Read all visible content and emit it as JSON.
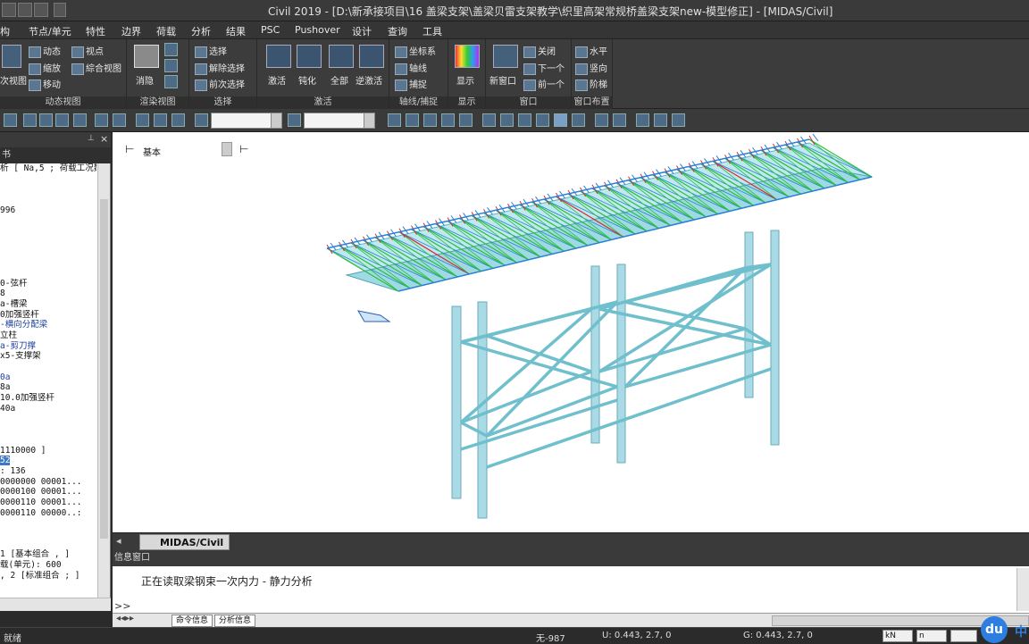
{
  "window": {
    "title": "Civil 2019 - [D:\\新承接项目\\16 盖梁支架\\盖梁贝雷支架教学\\织里高架常规桥盖梁支架new-模型修正] - [MIDAS/Civil]"
  },
  "menubar": [
    "构",
    "节点/单元",
    "特性",
    "边界",
    "荷载",
    "分析",
    "结果",
    "PSC",
    "Pushover",
    "设计",
    "查询",
    "工具"
  ],
  "ribbon": {
    "groups": [
      "动态视图",
      "渲染视图",
      "选择",
      "激活",
      "轴线/捕捉",
      "显示",
      "窗口",
      "窗口布置"
    ],
    "dynamic": {
      "prev_view": "次视图",
      "dynamic": "动态",
      "zoom": "缩放",
      "move": "移动",
      "viewpoint": "视点",
      "combo_view": "綜合视图"
    },
    "render": {
      "hide": "消隐"
    },
    "select": {
      "select": "选择",
      "unselect": "解除选择",
      "prev_select": "前次选择"
    },
    "activate": {
      "activate": "激活",
      "deactivate": "钝化",
      "all": "全部",
      "inverse": "逆激活"
    },
    "axis": {
      "coord": "坐标系",
      "axis": "轴线",
      "snap": "捕捉"
    },
    "display": {
      "display": "显示"
    },
    "window": {
      "new_window": "新窗口",
      "close": "关闭",
      "next": "下一个",
      "prev": "前一个"
    },
    "layout": {
      "horizontal": "水平",
      "vertical": "竖向",
      "cascade": "阶梯"
    }
  },
  "viewport": {
    "view_label": "基本"
  },
  "leftpane": {
    "header": "书",
    "lines": [
      {
        "t": "析 [ Na,5 ; 荷载工况数",
        "c": "n"
      },
      {
        "t": "",
        "c": "n"
      },
      {
        "t": "",
        "c": "n"
      },
      {
        "t": "",
        "c": "n"
      },
      {
        "t": "996",
        "c": "n"
      },
      {
        "t": "",
        "c": "n"
      },
      {
        "t": "",
        "c": "n"
      },
      {
        "t": "",
        "c": "n"
      },
      {
        "t": "",
        "c": "n"
      },
      {
        "t": "",
        "c": "n"
      },
      {
        "t": "",
        "c": "n"
      },
      {
        "t": "0-弦杆",
        "c": "n"
      },
      {
        "t": "8",
        "c": "n"
      },
      {
        "t": "a-槽梁",
        "c": "n"
      },
      {
        "t": "0加强竖杆",
        "c": "n"
      },
      {
        "t": "-横向分配梁",
        "c": "b"
      },
      {
        "t": "立柱",
        "c": "n"
      },
      {
        "t": "a-剪刀撑",
        "c": "b"
      },
      {
        "t": "x5-支撑架",
        "c": "n"
      },
      {
        "t": "",
        "c": "n"
      },
      {
        "t": "0a",
        "c": "b"
      },
      {
        "t": "8a",
        "c": "n"
      },
      {
        "t": "10.0加强竖杆",
        "c": "n"
      },
      {
        "t": "40a",
        "c": "n"
      },
      {
        "t": "",
        "c": "n"
      },
      {
        "t": "",
        "c": "n"
      },
      {
        "t": "",
        "c": "n"
      },
      {
        "t": "1110000 ]",
        "c": "n"
      },
      {
        "t": "52",
        "c": "s"
      },
      {
        "t": ": 136",
        "c": "n"
      },
      {
        "t": "0000000 00001...",
        "c": "n"
      },
      {
        "t": "0000100 00001...",
        "c": "n"
      },
      {
        "t": "0000110 00001...",
        "c": "n"
      },
      {
        "t": "0000110 00000..:",
        "c": "n"
      },
      {
        "t": "",
        "c": "n"
      },
      {
        "t": "",
        "c": "n"
      },
      {
        "t": "",
        "c": "n"
      },
      {
        "t": "1 [基本组合 , ]",
        "c": "n"
      },
      {
        "t": "载(单元): 600",
        "c": "n"
      },
      {
        "t": ", 2 [标准组合 ; ]",
        "c": "n"
      }
    ]
  },
  "doctab": {
    "label": "MIDAS/Civil"
  },
  "info": {
    "header": "信息窗口",
    "message": "正在读取梁钢束一次内力 - 静力分析",
    "prompt": ">>"
  },
  "bottomtabs": [
    "命令信息",
    "分析信息"
  ],
  "status": {
    "left": "就绪",
    "none": "无-987",
    "u": "U: 0.443, 2.7, 0",
    "g": "G: 0.443, 2.7, 0",
    "unit_force": "kN",
    "unit_len": "n"
  },
  "logo": {
    "mark": "du",
    "text": "中"
  },
  "colors": {
    "structure": "#8fd3e0",
    "truss_hot": "#d82b2b",
    "truss_mid": "#2bbf3a",
    "truss_cool": "#2a7fd8"
  }
}
